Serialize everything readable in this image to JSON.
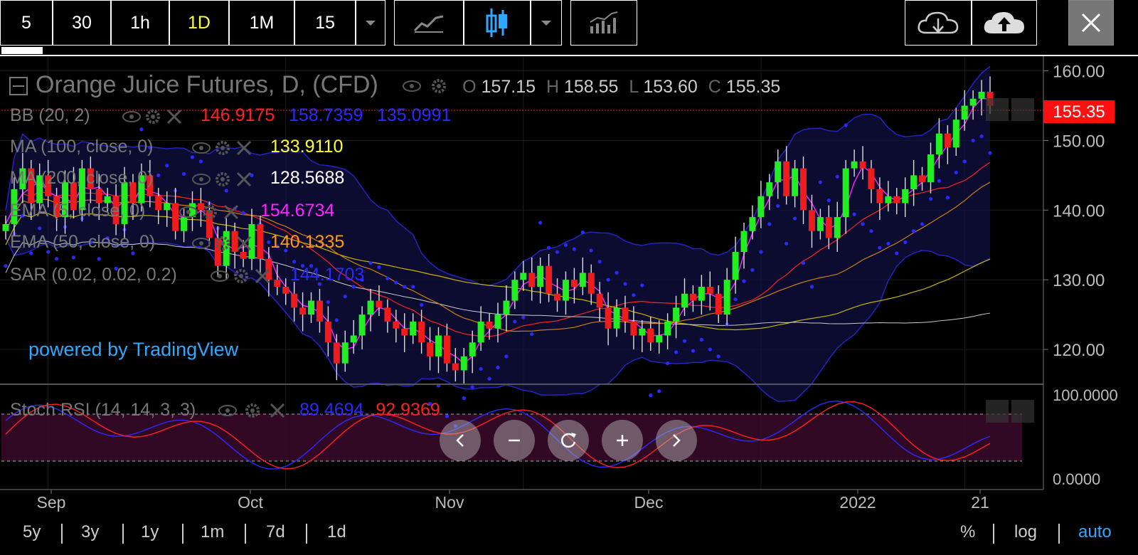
{
  "toolbar": {
    "intervals": [
      "5",
      "30",
      "1h",
      "1D",
      "1M",
      "15"
    ],
    "active_interval": "1D",
    "icons": [
      "interval-dropdown-icon",
      "line-chart-icon",
      "candle-chart-icon",
      "chart-type-dropdown-icon",
      "indicators-icon",
      "cloud-download-icon",
      "cloud-upload-icon",
      "close-icon"
    ]
  },
  "symbol": {
    "title": "Orange Juice Futures, D, (CFD)",
    "open_label": "O",
    "open": "157.15",
    "high_label": "H",
    "high": "158.55",
    "low_label": "L",
    "low": "153.60",
    "close_label": "C",
    "close": "155.35",
    "last_price": "155.35"
  },
  "indicators": [
    {
      "label": "BB (20, 2)",
      "values": [
        "146.9175",
        "158.7359",
        "135.0991"
      ],
      "colors": [
        "#ff2020",
        "#2a2aff",
        "#2a2aff"
      ]
    },
    {
      "label": "MA (100, close, 0)",
      "values": [
        "133.9110"
      ],
      "colors": [
        "#ffff30"
      ]
    },
    {
      "label": "MA (200, close, 0)",
      "values": [
        "128.5688"
      ],
      "colors": [
        "#ffffff"
      ]
    },
    {
      "label": "EMA (5, close, 0)",
      "values": [
        "154.6734"
      ],
      "colors": [
        "#ff22ff"
      ]
    },
    {
      "label": "EMA (50, close, 0)",
      "values": [
        "140.1335"
      ],
      "colors": [
        "#ff9a10"
      ]
    },
    {
      "label": "SAR (0.02, 0.02, 0.2)",
      "values": [
        "144.1703"
      ],
      "colors": [
        "#2a2aff"
      ]
    }
  ],
  "watermark": "powered by TradingView",
  "stoch": {
    "label": "Stoch RSI (14, 14, 3, 3)",
    "k": "89.4694",
    "d": "92.9369",
    "k_color": "#2a2aff",
    "d_color": "#ff2020"
  },
  "price_axis": {
    "ticks": [
      "160.00",
      "150.00",
      "140.00",
      "130.00",
      "120.00"
    ]
  },
  "stoch_axis": {
    "ticks": [
      "100.0000",
      "0.0000"
    ]
  },
  "time_axis": {
    "labels": [
      "Sep",
      "Oct",
      "Nov",
      "Dec",
      "2022",
      "21"
    ]
  },
  "ranges": [
    "5y",
    "3y",
    "1y",
    "1m",
    "7d",
    "1d"
  ],
  "scale_options": [
    "%",
    "log",
    "auto"
  ],
  "active_scale": "auto",
  "colors": {
    "up": "#22ee22",
    "down": "#ee1c1c",
    "accent": "#ffff3c",
    "scale_active": "#2fa8ff",
    "watermark": "#2fa8ff"
  },
  "chart_data": {
    "type": "candlestick",
    "title": "Orange Juice Futures, D, (CFD)",
    "ylim": [
      115,
      162
    ],
    "x_labels": [
      "Sep",
      "Oct",
      "Nov",
      "Dec",
      "2022",
      "21"
    ],
    "closes": [
      138,
      143,
      146,
      141,
      145,
      142,
      139,
      144,
      140,
      146,
      143,
      141,
      142,
      138,
      144,
      141,
      145,
      142,
      140,
      141,
      137,
      139,
      141,
      140,
      136,
      132,
      137,
      134,
      133,
      138,
      133,
      130,
      129,
      128,
      126,
      125,
      127,
      124,
      121,
      118,
      121,
      122,
      125,
      127,
      126,
      124,
      123,
      122,
      124,
      121,
      119,
      122,
      118,
      117,
      119,
      121,
      124,
      123,
      125,
      127,
      130,
      131,
      129,
      132,
      128,
      127,
      130,
      129,
      131,
      128,
      126,
      123,
      126,
      124,
      122,
      123,
      121,
      122,
      124,
      126,
      128,
      127,
      129,
      128,
      125,
      130,
      134,
      137,
      139,
      142,
      144,
      147,
      142,
      146,
      140,
      137,
      139,
      136,
      139,
      146,
      147,
      146,
      143,
      141,
      142,
      141,
      143,
      145,
      144,
      148,
      151,
      149,
      153,
      155,
      156,
      157,
      155
    ]
  }
}
